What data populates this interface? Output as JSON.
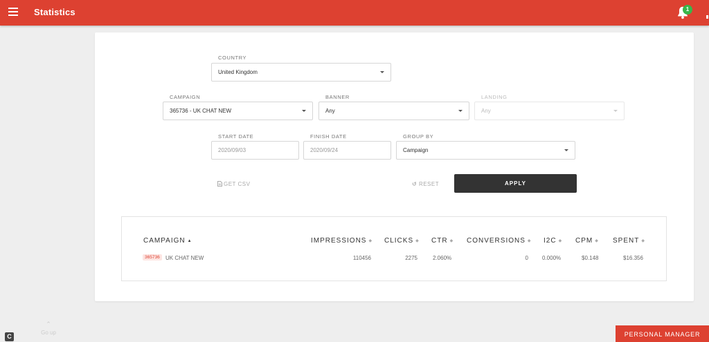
{
  "header": {
    "title": "Statistics",
    "notification_count": "1"
  },
  "filters": {
    "country": {
      "label": "COUNTRY",
      "value": "United Kingdom"
    },
    "campaign": {
      "label": "CAMPAIGN",
      "value": "365736 - UK CHAT NEW"
    },
    "banner": {
      "label": "BANNER",
      "value": "Any"
    },
    "landing": {
      "label": "LANDING",
      "value": "Any"
    },
    "start_date": {
      "label": "START DATE",
      "value": "2020/09/03"
    },
    "finish_date": {
      "label": "FINISH DATE",
      "value": "2020/09/24"
    },
    "group_by": {
      "label": "GROUP BY",
      "value": "Campaign"
    }
  },
  "actions": {
    "get_csv": "GET CSV",
    "reset": "RESET",
    "apply": "APPLY"
  },
  "table": {
    "columns": [
      "CAMPAIGN",
      "IMPRESSIONS",
      "CLICKS",
      "CTR",
      "CONVERSIONS",
      "I2C",
      "CPM",
      "SPENT"
    ],
    "rows": [
      {
        "id": "365736",
        "name": "UK CHAT NEW",
        "impressions": "110456",
        "clicks": "2275",
        "ctr": "2.060%",
        "conversions": "0",
        "i2c": "0.000%",
        "cpm": "$0.148",
        "spent": "$16.356"
      }
    ]
  },
  "footer": {
    "go_up": "Go up",
    "logo_letter": "C",
    "personal_manager": "PERSONAL MANAGER"
  },
  "colors": {
    "brand": "#dd4131",
    "badge": "#39b54a",
    "apply_bg": "#333333"
  }
}
